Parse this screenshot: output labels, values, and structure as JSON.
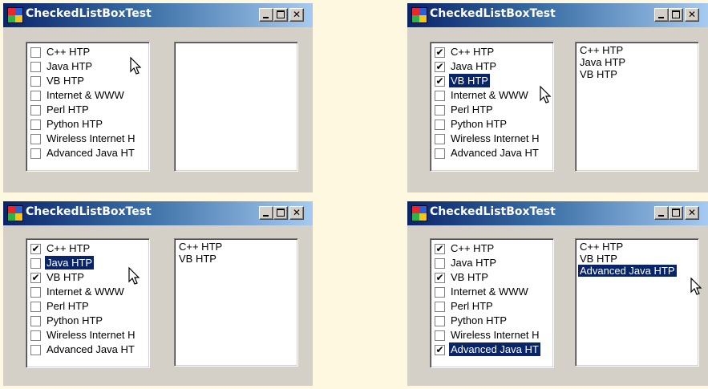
{
  "windows": [
    {
      "title": "CheckedListBoxTest",
      "checked_list": [
        {
          "label": "C++ HTP",
          "checked": false
        },
        {
          "label": "Java HTP",
          "checked": false
        },
        {
          "label": "VB HTP",
          "checked": false
        },
        {
          "label": "Internet & WWW",
          "checked": false
        },
        {
          "label": "Perl HTP",
          "checked": false
        },
        {
          "label": "Python HTP",
          "checked": false
        },
        {
          "label": "Wireless Internet H",
          "checked": false
        },
        {
          "label": "Advanced Java HT",
          "checked": false
        }
      ],
      "list": []
    },
    {
      "title": "CheckedListBoxTest",
      "checked_list": [
        {
          "label": "C++ HTP",
          "checked": true
        },
        {
          "label": "Java HTP",
          "checked": true
        },
        {
          "label": "VB HTP",
          "checked": true,
          "selected": true
        },
        {
          "label": "Internet & WWW",
          "checked": false
        },
        {
          "label": "Perl HTP",
          "checked": false
        },
        {
          "label": "Python HTP",
          "checked": false
        },
        {
          "label": "Wireless Internet H",
          "checked": false
        },
        {
          "label": "Advanced Java HT",
          "checked": false
        }
      ],
      "list": [
        {
          "label": "C++ HTP"
        },
        {
          "label": "Java HTP"
        },
        {
          "label": "VB HTP"
        }
      ]
    },
    {
      "title": "CheckedListBoxTest",
      "checked_list": [
        {
          "label": "C++ HTP",
          "checked": true
        },
        {
          "label": "Java HTP",
          "checked": false,
          "selected": true
        },
        {
          "label": "VB HTP",
          "checked": true
        },
        {
          "label": "Internet & WWW",
          "checked": false
        },
        {
          "label": "Perl HTP",
          "checked": false
        },
        {
          "label": "Python HTP",
          "checked": false
        },
        {
          "label": "Wireless Internet H",
          "checked": false
        },
        {
          "label": "Advanced Java HT",
          "checked": false
        }
      ],
      "list": [
        {
          "label": "C++ HTP"
        },
        {
          "label": "VB HTP"
        }
      ]
    },
    {
      "title": "CheckedListBoxTest",
      "checked_list": [
        {
          "label": "C++ HTP",
          "checked": true
        },
        {
          "label": "Java HTP",
          "checked": false
        },
        {
          "label": "VB HTP",
          "checked": true
        },
        {
          "label": "Internet & WWW",
          "checked": false
        },
        {
          "label": "Perl HTP",
          "checked": false
        },
        {
          "label": "Python HTP",
          "checked": false
        },
        {
          "label": "Wireless Internet H",
          "checked": false
        },
        {
          "label": "Advanced Java HT",
          "checked": true,
          "selected": true
        }
      ],
      "list": [
        {
          "label": "C++ HTP"
        },
        {
          "label": "VB HTP"
        },
        {
          "label": "Advanced Java HTP",
          "selected": true
        }
      ]
    }
  ],
  "icons": {
    "app": "app-icon",
    "minimize": "minimize-icon",
    "maximize": "maximize-icon",
    "close": "close-icon",
    "cursor": "mouse-pointer-icon",
    "check": "✔"
  },
  "close_glyph": "✕",
  "colors": {
    "selection": "#0a246a",
    "window_face": "#d4d0c8",
    "title_gradient_start": "#0a246a",
    "title_gradient_end": "#a6caf0",
    "page_background": "#fff8e0"
  }
}
